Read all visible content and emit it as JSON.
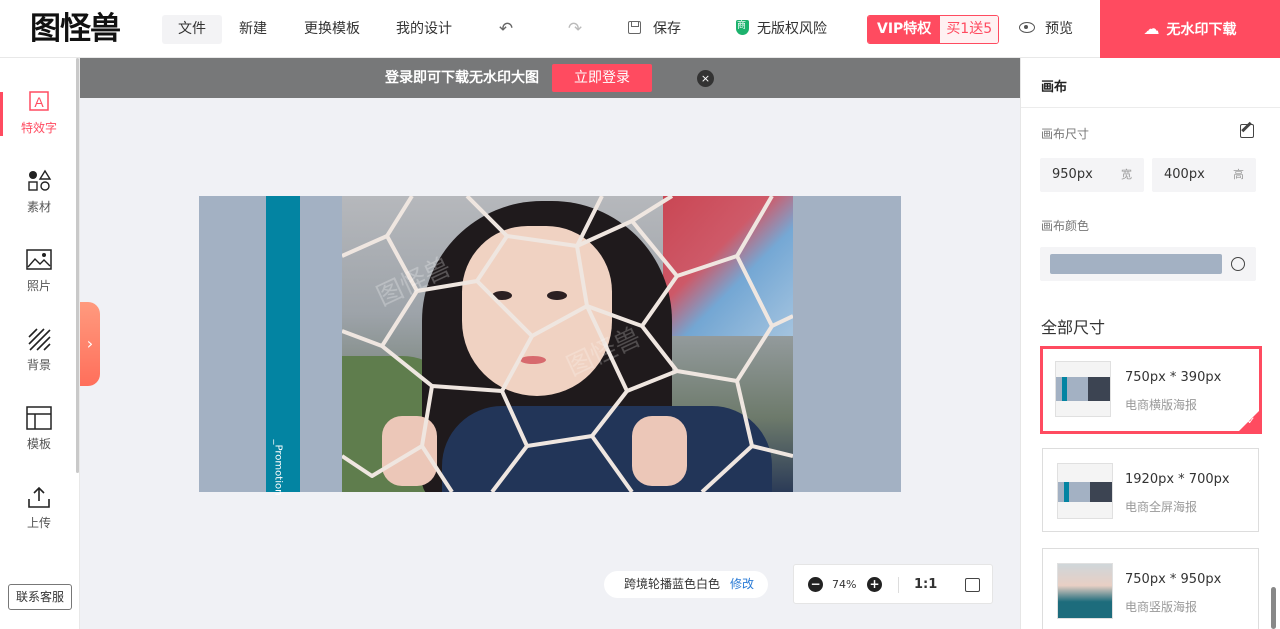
{
  "app": {
    "logo_text": "图怪兽"
  },
  "topbar": {
    "menus": [
      "文件",
      "新建",
      "更换模板",
      "我的设计"
    ],
    "undo_icon": "undo-icon",
    "redo_icon": "redo-icon",
    "save_label": "保存",
    "risk_label": "无版权风险",
    "vip_label": "VIP特权",
    "vip_promo": "买1送5",
    "preview_label": "预览",
    "download_label": "无水印下载"
  },
  "leftbar": {
    "items": [
      {
        "label": "特效字",
        "icon": "text-effect-icon"
      },
      {
        "label": "素材",
        "icon": "shapes-icon"
      },
      {
        "label": "照片",
        "icon": "photo-icon"
      },
      {
        "label": "背景",
        "icon": "background-icon"
      },
      {
        "label": "模板",
        "icon": "template-icon"
      },
      {
        "label": "上传",
        "icon": "upload-icon"
      }
    ],
    "support_label": "联系客服"
  },
  "banner": {
    "text": "登录即可下载无水印大图",
    "login_label": "立即登录",
    "close_symbol": "×"
  },
  "canvas": {
    "background": "#a3b1c3",
    "stripe_color": "#0384a2",
    "stripe_text": "_Promotion",
    "watermark": "图怪兽"
  },
  "bottom": {
    "template_name": "跨境轮播蓝色白色",
    "edit_label": "修改",
    "zoom_percent": "74%",
    "one_to_one": "1:1"
  },
  "rightpanel": {
    "title": "画布",
    "size_label": "画布尺寸",
    "width_value": "950px",
    "width_unit": "宽",
    "height_value": "400px",
    "height_unit": "高",
    "color_label": "画布颜色",
    "color_value": "#a3b1c3",
    "all_sizes_label": "全部尺寸",
    "sizes": [
      {
        "dim": "750px * 390px",
        "name": "电商横版海报",
        "selected": true
      },
      {
        "dim": "1920px * 700px",
        "name": "电商全屏海报",
        "selected": false
      },
      {
        "dim": "750px * 950px",
        "name": "电商竖版海报",
        "selected": false
      }
    ]
  }
}
